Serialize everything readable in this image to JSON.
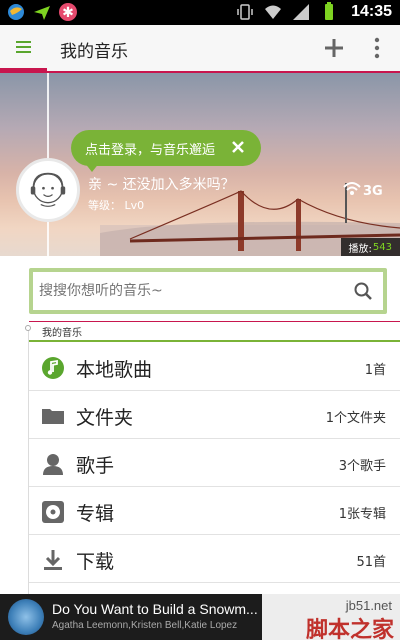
{
  "status_bar": {
    "time": "14:35",
    "left_icons": [
      "browser-icon",
      "send-icon",
      "asterisk-app-icon"
    ],
    "right_icons": [
      "vibrate-icon",
      "wifi-icon",
      "signal-icon",
      "battery-icon"
    ]
  },
  "app_bar": {
    "title": "我的音乐",
    "menu_icon": "hamburger-icon",
    "add_icon": "plus-icon",
    "more_icon": "more-vert-icon"
  },
  "hero": {
    "login_prompt": "点击登录，与音乐邂逅",
    "greeting": "亲 ~ 还没加入多米吗？",
    "level": "等级： Lv0",
    "network_label": "3G",
    "play_label": "播放:",
    "play_count": "543"
  },
  "search": {
    "placeholder": "搜搜你想听的音乐~"
  },
  "section": {
    "label": "我的音乐"
  },
  "list": [
    {
      "icon": "music-note-icon",
      "label": "本地歌曲",
      "count": "1首"
    },
    {
      "icon": "folder-icon",
      "label": "文件夹",
      "count": "1个文件夹"
    },
    {
      "icon": "singer-icon",
      "label": "歌手",
      "count": "3个歌手"
    },
    {
      "icon": "album-icon",
      "label": "专辑",
      "count": "1张专辑"
    },
    {
      "icon": "download-icon",
      "label": "下载",
      "count": "51首"
    }
  ],
  "now_playing": {
    "title": "Do You Want to Build a Snowm...",
    "artist": "Agatha Leemonn,Kristen Bell,Katie Lopez"
  },
  "watermark": {
    "url": "jb51.net",
    "name": "脚本之家"
  },
  "colors": {
    "accent_green": "#7ab337",
    "accent_pink": "#c8164e"
  }
}
